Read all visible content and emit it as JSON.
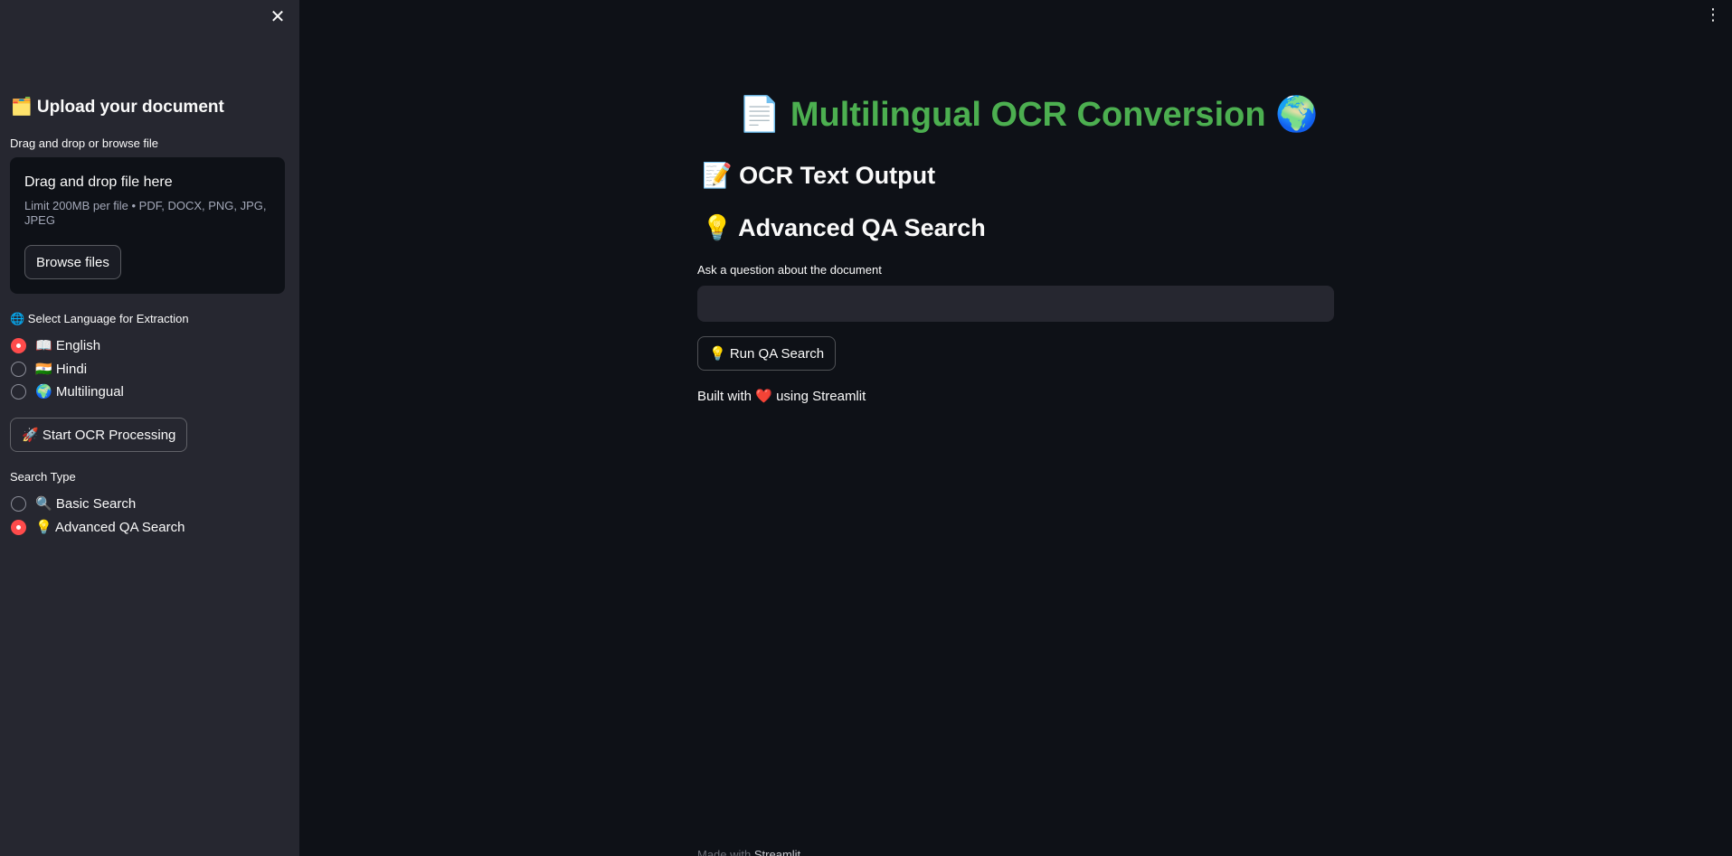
{
  "sidebar": {
    "close_icon": "✕",
    "upload_heading": "🗂️ Upload your document",
    "uploader_label": "Drag and drop or browse file",
    "dropzone": {
      "title": "Drag and drop file here",
      "limit": "Limit 200MB per file • PDF, DOCX, PNG, JPG, JPEG",
      "browse_label": "Browse files"
    },
    "language_label": "🌐 Select Language for Extraction",
    "languages": [
      {
        "label": "📖 English",
        "selected": true
      },
      {
        "label": "🇮🇳 Hindi",
        "selected": false
      },
      {
        "label": "🌍 Multilingual",
        "selected": false
      }
    ],
    "start_button": "🚀 Start OCR Processing",
    "search_type_label": "Search Type",
    "search_types": [
      {
        "label": "🔍 Basic Search",
        "selected": false
      },
      {
        "label": "💡 Advanced QA Search",
        "selected": true
      }
    ]
  },
  "main": {
    "menu_icon": "⋮",
    "title": "📄 Multilingual OCR Conversion 🌍",
    "ocr_heading": "📝 OCR Text Output",
    "qa_heading": "💡 Advanced QA Search",
    "qa_label": "Ask a question about the document",
    "qa_value": "",
    "qa_button": "💡 Run QA Search",
    "built_with_prefix": "Built with",
    "built_with_heart": "❤️",
    "built_with_suffix": "using Streamlit",
    "footer_prefix": "Made with",
    "footer_link": "Streamlit"
  },
  "colors": {
    "background": "#0e1117",
    "sidebar": "#262730",
    "accent": "#ff4b4b",
    "title_green": "#4caf50"
  }
}
